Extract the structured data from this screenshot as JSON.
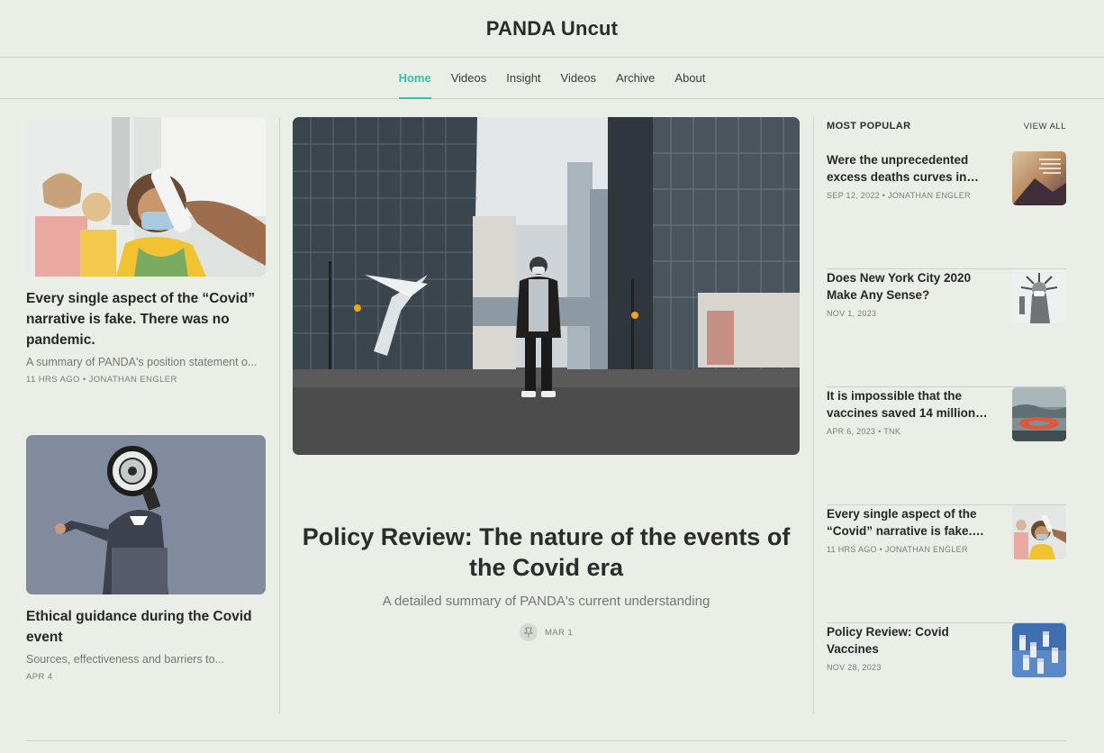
{
  "site": {
    "title": "PANDA Uncut"
  },
  "nav": {
    "items": [
      {
        "label": "Home",
        "active": true
      },
      {
        "label": "Videos",
        "active": false
      },
      {
        "label": "Insight",
        "active": false
      },
      {
        "label": "Videos",
        "active": false
      },
      {
        "label": "Archive",
        "active": false
      },
      {
        "label": "About",
        "active": false
      }
    ]
  },
  "left": {
    "cards": [
      {
        "title": "Every single aspect of the “Covid” narrative is fake. There was no pandemic.",
        "subtitle": "A summary of PANDA's position statement o...",
        "meta": "11 HRS AGO • JONATHAN ENGLER"
      },
      {
        "title": "Ethical guidance during the Covid event",
        "subtitle": "Sources, effectiveness and barriers to...",
        "meta": "APR 4"
      }
    ]
  },
  "hero": {
    "title": "Policy Review: The nature of the events of the Covid era",
    "subtitle": "A detailed summary of PANDA's current understanding",
    "date": "MAR 1",
    "pin_icon": "pin-icon"
  },
  "popular": {
    "heading": "MOST POPULAR",
    "view_all": "VIEW ALL",
    "items": [
      {
        "title": "Were the unprecedented excess deaths curves in…",
        "meta": "SEP 12, 2022 • JONATHAN ENGLER"
      },
      {
        "title": "Does New York City 2020 Make Any Sense?",
        "meta": "NOV 1, 2023"
      },
      {
        "title": "It is impossible that the vaccines saved 14 million…",
        "meta": "APR 6, 2023 • TNK"
      },
      {
        "title": "Every single aspect of the “Covid” narrative is fake.…",
        "meta": "11 HRS AGO • JONATHAN ENGLER"
      },
      {
        "title": "Policy Review: Covid Vaccines",
        "meta": "NOV 28, 2023"
      }
    ]
  },
  "colors": {
    "accent": "#3cbfa7",
    "background": "#e9efe7",
    "divider": "#cdd3cb"
  }
}
